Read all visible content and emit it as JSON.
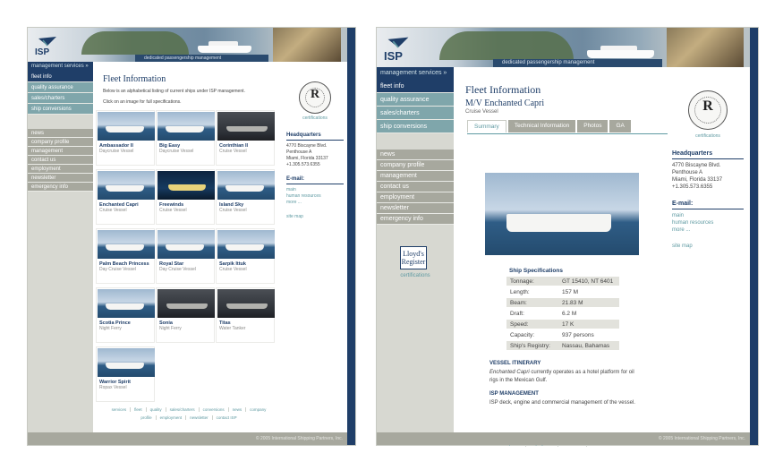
{
  "common": {
    "logo_text": "ISP",
    "tagline": "dedicated passengership management",
    "menu_header": "management services »",
    "primary_menu": [
      "fleet info",
      "quality assurance",
      "sales/charters",
      "ship conversions"
    ],
    "secondary_menu": [
      "news",
      "company profile",
      "management",
      "contact us",
      "employment",
      "newsletter",
      "emergency info"
    ],
    "page_title": "Fleet Information",
    "certifications_label": "certifications",
    "hq_heading": "Headquarters",
    "hq_lines": [
      "4770 Biscayne Blvd.",
      "Penthouse  A",
      "Miami, Florida  33137",
      "+1.305.573.6355"
    ],
    "email_heading": "E-mail:",
    "email_links": [
      "main",
      "human resources",
      "more ..."
    ],
    "site_map": "site map",
    "footer_row1": [
      "services",
      "fleet",
      "quality",
      "sales/charters",
      "conversions",
      "news",
      "company"
    ],
    "footer_row2": [
      "profile",
      "employment",
      "newsletter",
      "contact ISP"
    ],
    "copyright": "© 2005 International Shipping Partners, Inc.",
    "colors": {
      "navy": "#1f3e68",
      "teal": "#7fa6ab",
      "grey": "#a7a89e",
      "link": "#5f9aa2"
    }
  },
  "left": {
    "intro1": "Below is an alphabetical listing of current ships under ISP management.",
    "intro2": "Click on an image for full specifications.",
    "ships": [
      {
        "name": "Ambassador II",
        "type": "Daycruise Vessel"
      },
      {
        "name": "Big Easy",
        "type": "Daycruise Vessel"
      },
      {
        "name": "Corinthian II",
        "type": "Cruise Vessel"
      },
      {
        "name": "Enchanted Capri",
        "type": "Cruise Vessel"
      },
      {
        "name": "Freewinds",
        "type": "Cruise Vessel"
      },
      {
        "name": "Island Sky",
        "type": "Cruise Vessel"
      },
      {
        "name": "Palm Beach Princess",
        "type": "Day Cruise Vessel"
      },
      {
        "name": "Royal Star",
        "type": "Day Cruise Vessel"
      },
      {
        "name": "Sarpik Ittuk",
        "type": "Cruise Vessel"
      },
      {
        "name": "Scotia Prince",
        "type": "Night Ferry"
      },
      {
        "name": "Sonia",
        "type": "Night Ferry"
      },
      {
        "name": "Titas",
        "type": "Water Tanker"
      },
      {
        "name": "Warrior Spirit",
        "type": "Ropax Vessel"
      }
    ]
  },
  "right": {
    "ship_title": "M/V Enchanted Capri",
    "ship_subtitle": "Cruise Vessel",
    "tabs": [
      "Summary",
      "Technical Information",
      "Photos",
      "GA"
    ],
    "specs_heading": "Ship Specifications",
    "specs": [
      {
        "k": "Tonnage:",
        "v": "GT 15410, NT 6401"
      },
      {
        "k": "Length:",
        "v": "157 M"
      },
      {
        "k": "Beam:",
        "v": "21.83 M"
      },
      {
        "k": "Draft:",
        "v": "6.2 M"
      },
      {
        "k": "Speed:",
        "v": "17 K"
      },
      {
        "k": "Capacity:",
        "v": "937 persons"
      },
      {
        "k": "Ship's Registry:",
        "v": "Nassau, Bahamas"
      }
    ],
    "itinerary_heading": "VESSEL ITINERARY",
    "itinerary_ship": "Enchanted Capri",
    "itinerary_text": " currently operates as a hotel platform for oil rigs in the Mexican Gulf.",
    "management_heading": "ISP MANAGEMENT",
    "management_text": "ISP deck, engine and commercial management of the vessel.",
    "lloyds_line1": "Lloyd's",
    "lloyds_line2": "Register"
  }
}
